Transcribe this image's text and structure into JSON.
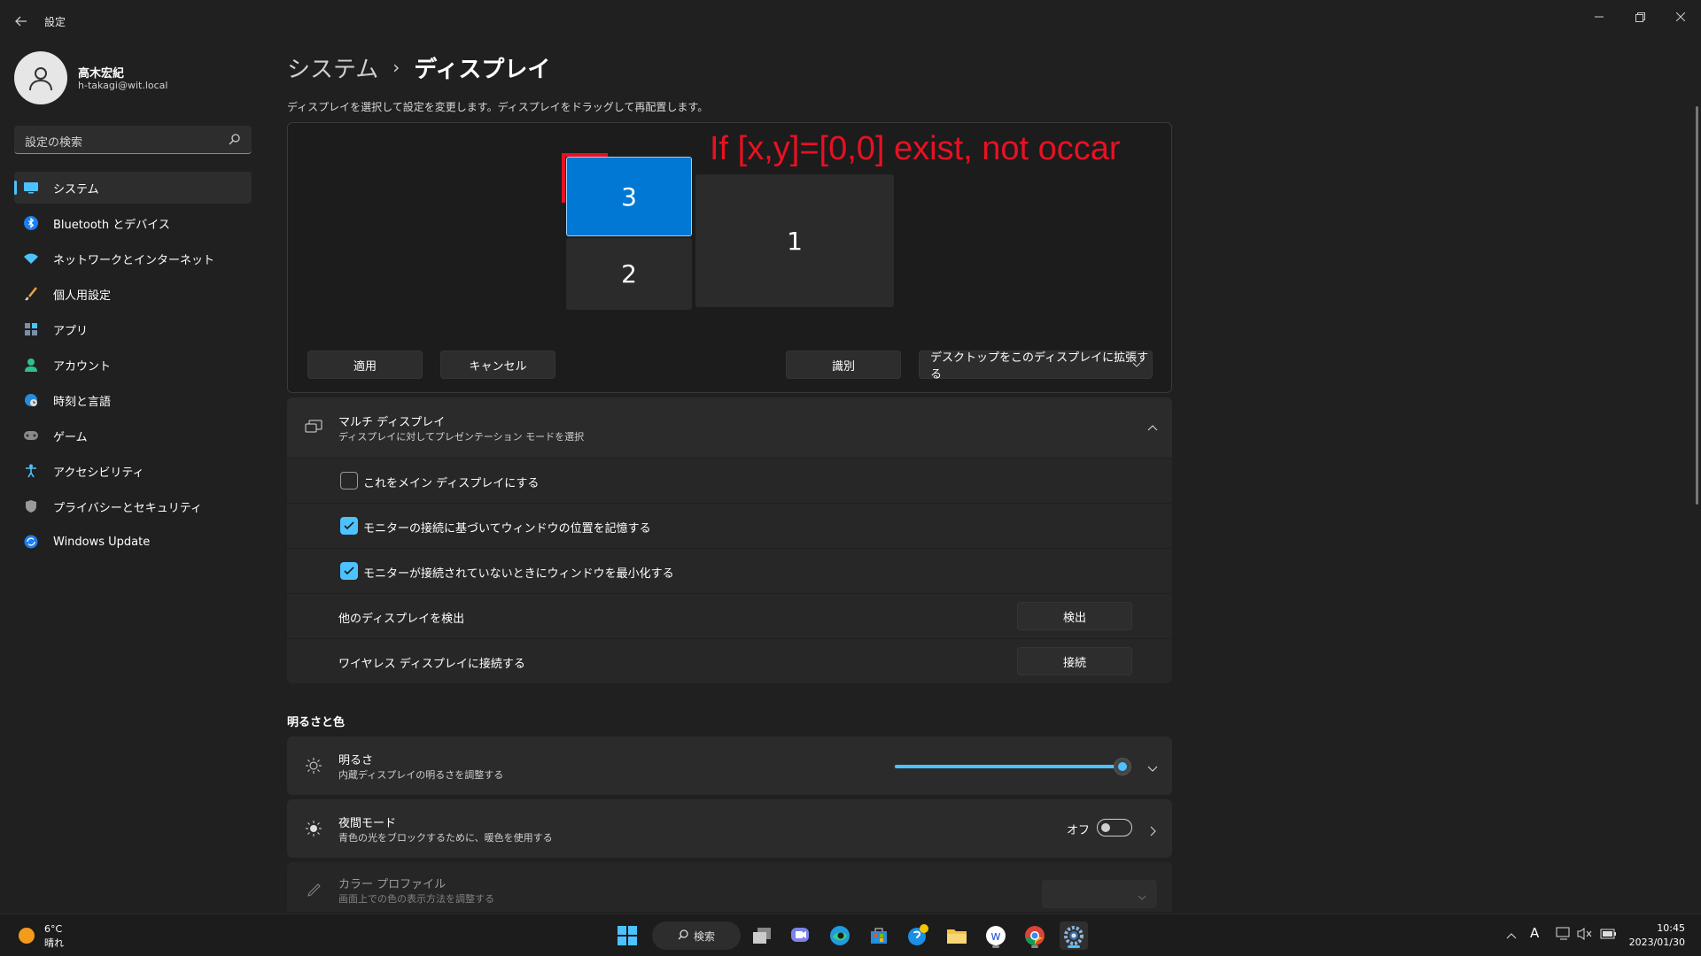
{
  "window": {
    "app_title": "設定",
    "back_icon": "back-arrow-icon",
    "controls": [
      "minimize-icon",
      "restore-icon",
      "close-icon"
    ]
  },
  "profile": {
    "name": "高木宏紀",
    "email": "h-takagi@wit.local"
  },
  "search": {
    "placeholder": "設定の検索"
  },
  "sidebar": {
    "items": [
      {
        "label": "システム",
        "icon": "monitor-icon",
        "active": true
      },
      {
        "label": "Bluetooth とデバイス",
        "icon": "bluetooth-icon"
      },
      {
        "label": "ネットワークとインターネット",
        "icon": "wifi-icon"
      },
      {
        "label": "個人用設定",
        "icon": "brush-icon"
      },
      {
        "label": "アプリ",
        "icon": "apps-icon"
      },
      {
        "label": "アカウント",
        "icon": "account-icon"
      },
      {
        "label": "時刻と言語",
        "icon": "globe-clock-icon"
      },
      {
        "label": "ゲーム",
        "icon": "gamepad-icon"
      },
      {
        "label": "アクセシビリティ",
        "icon": "accessibility-icon"
      },
      {
        "label": "プライバシーとセキュリティ",
        "icon": "shield-icon"
      },
      {
        "label": "Windows Update",
        "icon": "update-icon"
      }
    ]
  },
  "main": {
    "breadcrumb_parent": "システム",
    "breadcrumb_sep": "›",
    "breadcrumb_current": "ディスプレイ",
    "subtitle": "ディスプレイを選択して設定を変更します。ディスプレイをドラッグして再配置します。",
    "annotation": "If [x,y]=[0,0] exist, not occar",
    "monitors": [
      {
        "label": "3",
        "selected": true
      },
      {
        "label": "2",
        "selected": false
      },
      {
        "label": "1",
        "selected": false
      }
    ],
    "buttons": {
      "apply": "適用",
      "cancel": "キャンセル",
      "identify": "識別",
      "extend": "デスクトップをこのディスプレイに拡張する"
    },
    "multi_display": {
      "title": "マルチ ディスプレイ",
      "subtitle": "ディスプレイに対してプレゼンテーション モードを選択",
      "options": [
        {
          "label": "これをメイン ディスプレイにする",
          "checked": false
        },
        {
          "label": "モニターの接続に基づいてウィンドウの位置を記憶する",
          "checked": true
        },
        {
          "label": "モニターが接続されていないときにウィンドウを最小化する",
          "checked": true
        }
      ],
      "detect_label": "他のディスプレイを検出",
      "detect_button": "検出",
      "wireless_label": "ワイヤレス ディスプレイに接続する",
      "wireless_button": "接続"
    },
    "brightness_section": {
      "title": "明るさと色",
      "brightness_title": "明るさ",
      "brightness_sub": "内蔵ディスプレイの明るさを調整する",
      "brightness_value": 0.98,
      "night_title": "夜間モード",
      "night_sub": "青色の光をブロックするために、暖色を使用する",
      "night_state": "オフ",
      "profile_title": "カラー プロファイル",
      "profile_sub": "画面上での色の表示方法を調整する"
    }
  },
  "taskbar": {
    "weather_temp": "6°C",
    "weather_cond": "晴れ",
    "search_label": "検索",
    "time": "10:45",
    "date": "2023/01/30",
    "ime": "A"
  },
  "colors": {
    "accent": "#4cc2ff",
    "selected_monitor": "#0078d4",
    "annotation": "#e81123",
    "background": "#202020"
  }
}
